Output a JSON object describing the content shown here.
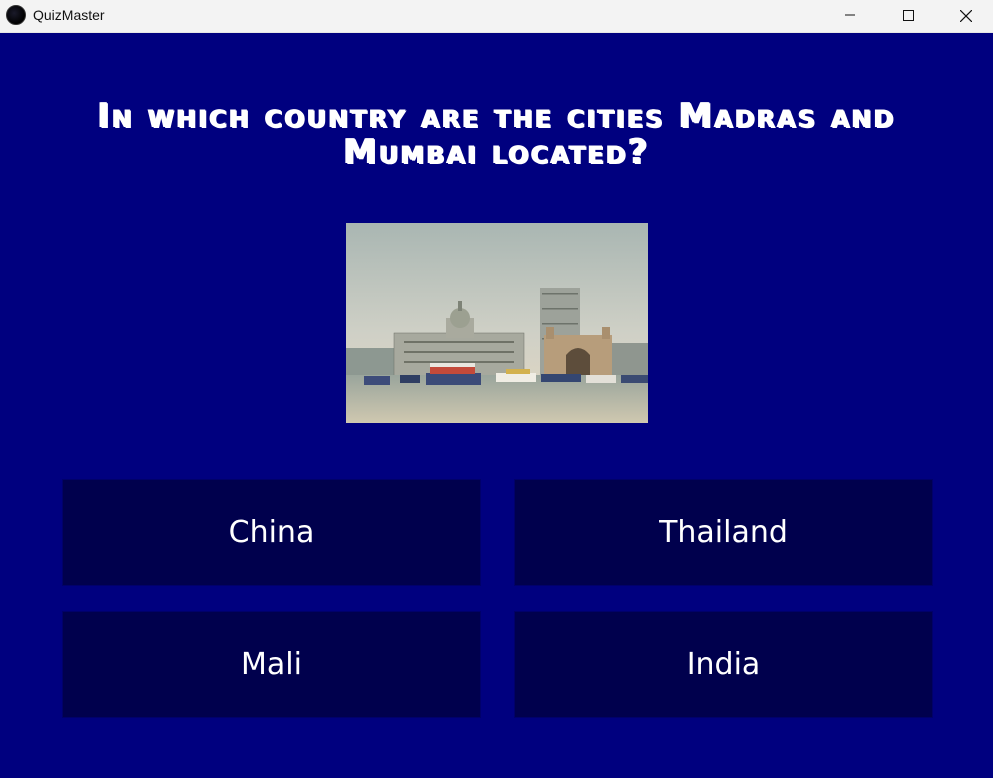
{
  "window": {
    "title": "QuizMaster",
    "controls": [
      "minimize",
      "maximize",
      "close"
    ]
  },
  "question": {
    "text": "In which country are the cities Madras and Mumbai located?"
  },
  "image": {
    "description_icon": "photo-mumbai-waterfront"
  },
  "answers": [
    {
      "label": "China"
    },
    {
      "label": "Thailand"
    },
    {
      "label": "Mali"
    },
    {
      "label": "India"
    }
  ],
  "colors": {
    "background": "#00007f",
    "answer_background": "#00004d",
    "text": "#ffffff",
    "titlebar": "#f3f3f3"
  }
}
